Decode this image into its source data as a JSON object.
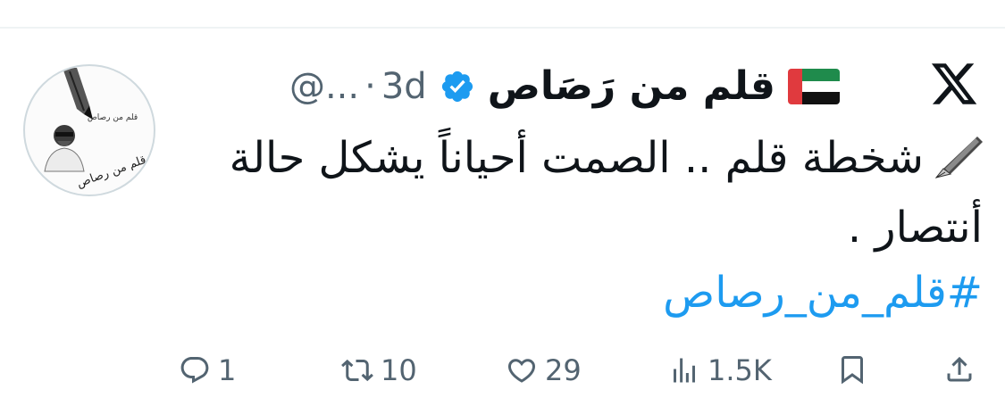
{
  "tweet": {
    "display_name": "قلم من رَصَاص",
    "handle": "@...",
    "separator": "·",
    "time": "3d",
    "text": "شخطة قلم .. الصمت أحياناً يشكل حالة أنتصار .",
    "hashtag": "#قلم_من_رصاص",
    "avatar_caption_small": "قلم من رصاص",
    "avatar_caption_large": "قلم من رصاص"
  },
  "icons": {
    "platform": "x-logo-icon",
    "verified": "verified-badge-icon",
    "flag": "uae-flag-icon",
    "pen": "fountain-pen-icon"
  },
  "actions": {
    "replies": "1",
    "reposts": "10",
    "likes": "29",
    "views": "1.5K"
  },
  "colors": {
    "text": "#0f1419",
    "secondary": "#536471",
    "link": "#1d9bf0",
    "verified": "#1d9bf0"
  }
}
